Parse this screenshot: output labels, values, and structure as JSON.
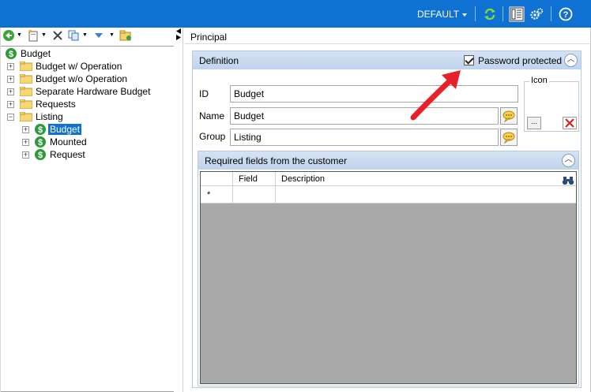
{
  "topbar": {
    "profile": "DEFAULT",
    "icons": [
      "refresh-icon",
      "layout-icon",
      "settings-gears-icon",
      "help-icon"
    ]
  },
  "left_toolbar": {
    "icons": [
      "back-icon",
      "new-icon",
      "delete-icon",
      "copy-icon",
      "move-down-icon",
      "folder-tools-icon"
    ]
  },
  "tree": {
    "root": "Budget",
    "items": [
      {
        "label": "Budget w/ Operation"
      },
      {
        "label": "Budget w/o Operation"
      },
      {
        "label": "Separate Hardware Budget"
      },
      {
        "label": "Requests"
      },
      {
        "label": "Listing"
      }
    ],
    "children": [
      {
        "label": "Budget",
        "selected": true
      },
      {
        "label": "Mounted"
      },
      {
        "label": "Request"
      }
    ]
  },
  "right": {
    "title": "Principal",
    "definition": {
      "header": "Definition",
      "password_label": "Password protected",
      "password_checked": true,
      "id_label": "ID",
      "id_value": "Budget",
      "name_label": "Name",
      "name_value": "Budget",
      "group_label": "Group",
      "group_value": "Listing",
      "icon_label": "Icon",
      "icon_browse": "..."
    },
    "required": {
      "header": "Required fields from the customer",
      "columns": [
        "Field",
        "Description"
      ],
      "new_row_marker": "*"
    }
  },
  "colors": {
    "topbar": "#0f72d2",
    "selection": "#0f72d2",
    "section_header": "#c9daef",
    "grid_background": "#a9a9a9",
    "annotation_arrow": "#e8202a"
  }
}
